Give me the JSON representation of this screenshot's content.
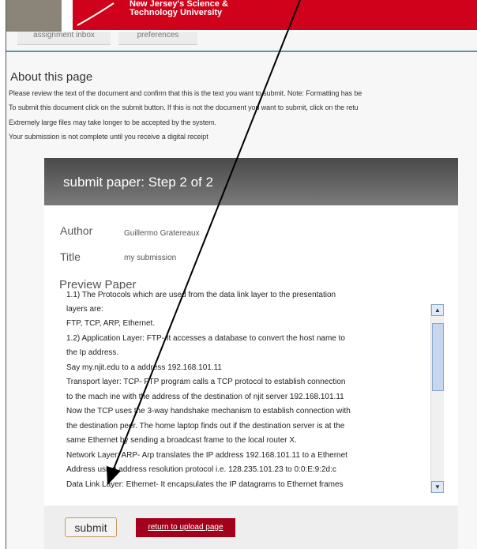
{
  "header": {
    "university_line1": "New Jersey's Science &",
    "university_line2": "Technology University"
  },
  "nav": {
    "tabs": [
      {
        "label": "assignment inbox"
      },
      {
        "label": "preferences"
      }
    ]
  },
  "about": {
    "title": "About this page",
    "lines": [
      "Please review the text of the document and confirm that this is the text you want to submit. Note: Formatting has be",
      "To submit this document click on the submit button. If this is not the document you want to submit, click on the retu",
      "Extremely large files may take longer to be accepted by the system.",
      "Your submission is not complete until you receive a digital receipt"
    ]
  },
  "panel": {
    "title": "submit paper: Step 2 of 2",
    "author_label": "Author",
    "author_value": "Guillermo Gratereaux",
    "title_label": "Title",
    "title_value": "my submission",
    "preview_label": "Preview Paper",
    "preview_lines": [
      "1.1) The Protocols which are used from the data link layer to the presentation",
      "layers are:",
      "FTP, TCP, ARP, Ethernet.",
      "1.2) Application Layer: FTP- It accesses a database to convert the host name to",
      "the Ip address.",
      "Say my.njit.edu to a address 192.168.101.11",
      "Transport layer: TCP- FTP program calls a TCP protocol to establish connection",
      "to the mach ine with the address of the destination of njit server 192.168.101.11",
      "Now the TCP uses the 3-way handshake mechanism to establish connection with",
      "the destination peer. The home laptop finds out if the destination server is at the",
      "same Ethernet by sending a broadcast frame to the local router X.",
      "Network Layer: ARP- Arp translates the IP address 192.168.101.11 to a Ethernet",
      "Address using address resolution protocol i.e. 128.235.101.23 to 0:0:E:9:2d:c",
      "Data Link Layer: Ethernet- It encapsulates the IP datagrams to Ethernet frames"
    ],
    "submit_label": "submit",
    "return_label": "return to upload page"
  },
  "colors": {
    "brand_red": "#d0021b",
    "return_button": "#a3001b",
    "nav_rule": "#5f93a9"
  }
}
